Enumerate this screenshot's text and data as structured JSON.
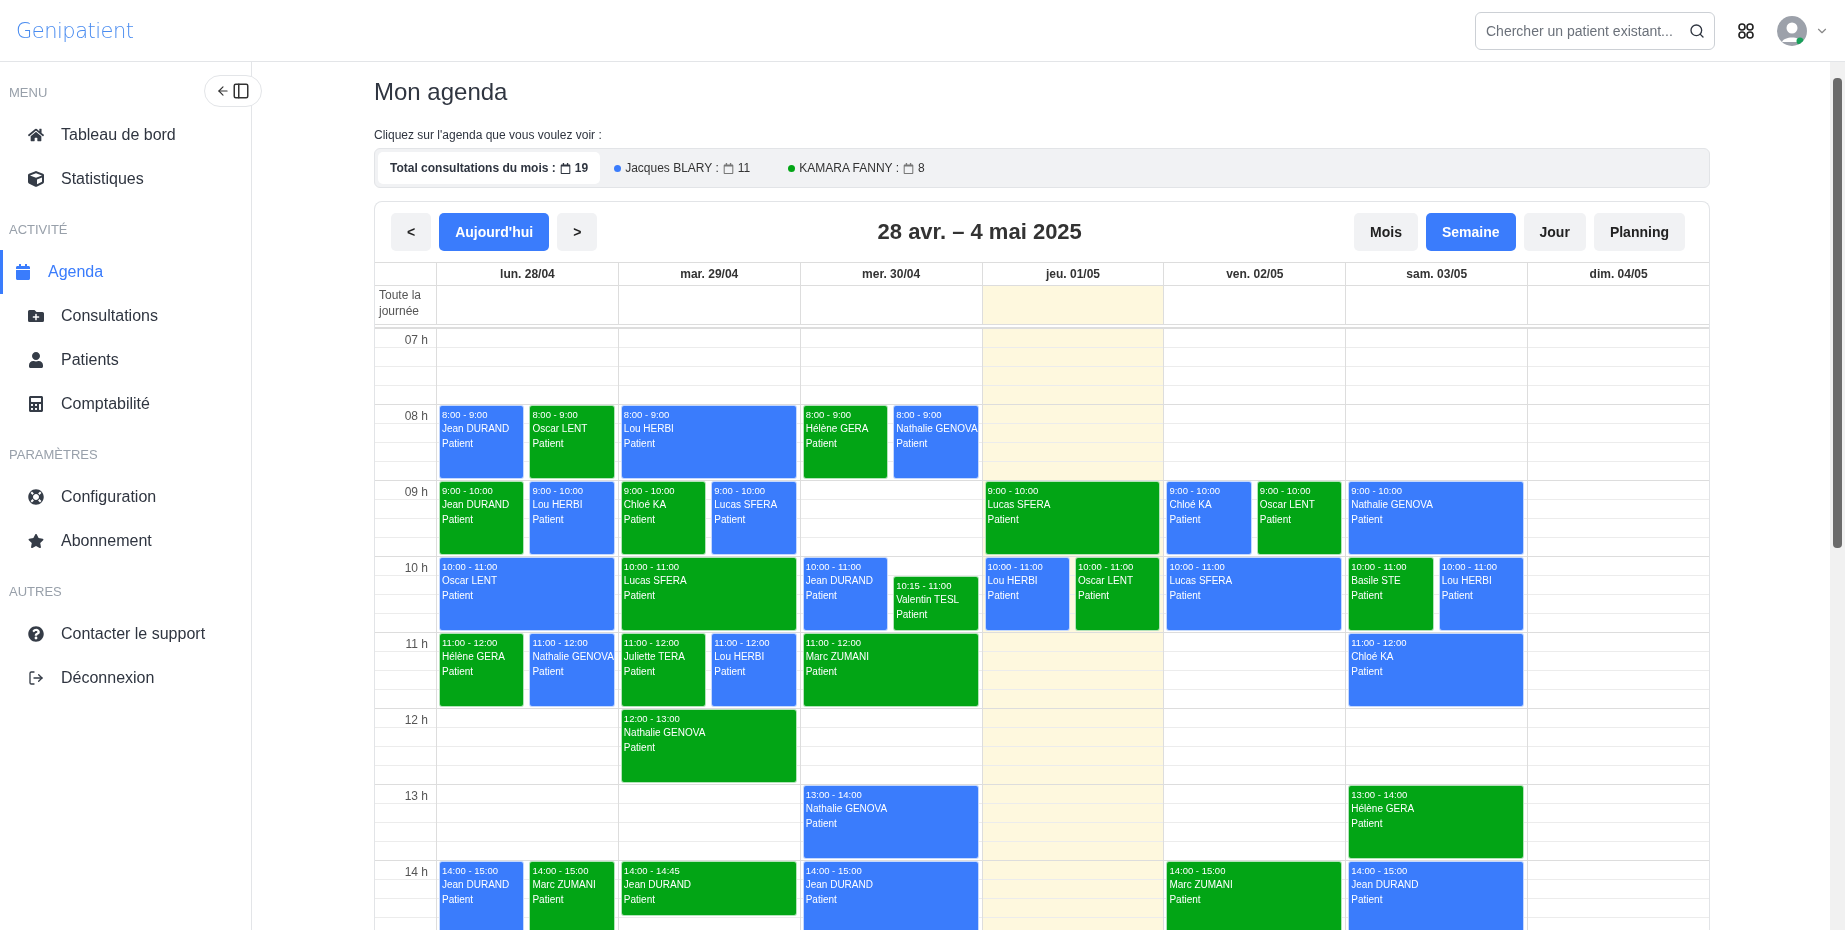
{
  "header": {
    "logo": "Genipatient",
    "search": {
      "placeholder": "Chercher un patient existant..."
    }
  },
  "sidebar": {
    "sections": [
      {
        "title": "MENU",
        "items": [
          {
            "label": "Tableau de bord",
            "selected": false
          },
          {
            "label": "Statistiques",
            "selected": false
          }
        ]
      },
      {
        "title": "ACTIVITÉ",
        "items": [
          {
            "label": "Agenda",
            "selected": true
          },
          {
            "label": "Consultations",
            "selected": false
          },
          {
            "label": "Patients",
            "selected": false
          },
          {
            "label": "Comptabilité",
            "selected": false
          }
        ]
      },
      {
        "title": "PARAMÈTRES",
        "items": [
          {
            "label": "Configuration",
            "selected": false
          },
          {
            "label": "Abonnement",
            "selected": false
          }
        ]
      },
      {
        "title": "AUTRES",
        "items": [
          {
            "label": "Contacter le support",
            "selected": false
          },
          {
            "label": "Déconnexion",
            "selected": false
          }
        ]
      }
    ]
  },
  "page": {
    "title": "Mon agenda",
    "hint": "Cliquez sur l'agenda que vous voulez voir :"
  },
  "legend": {
    "total_label": "Total consultations du mois :",
    "total": "19",
    "agendas": [
      {
        "name": "Jacques BLARY :",
        "count": "11",
        "color": "#3a7cfc"
      },
      {
        "name": "KAMARA FANNY :",
        "count": "8",
        "color": "#02a515"
      }
    ]
  },
  "calendar": {
    "nav": [
      {
        "label": "<",
        "kind": "plain"
      },
      {
        "label": "Aujourd'hui",
        "kind": "primary"
      },
      {
        "label": ">",
        "kind": "plain"
      }
    ],
    "title": "28 avr. – 4 mai 2025",
    "views": [
      {
        "label": "Mois",
        "selected": false
      },
      {
        "label": "Semaine",
        "selected": true
      },
      {
        "label": "Jour",
        "selected": false
      },
      {
        "label": "Planning",
        "selected": false
      }
    ],
    "allday_label": "Toute la journée",
    "hours": [
      "07 h",
      "08 h",
      "09 h",
      "10 h",
      "11 h",
      "12 h",
      "13 h",
      "14 h"
    ],
    "days": [
      {
        "label": "lun. 28/04",
        "today": false,
        "events": [
          {
            "time": "8:00 - 9:00",
            "name": "Jean DURAND",
            "role": "Patient",
            "color": "#3a7cfc"
          },
          {
            "time": "8:00 - 9:00",
            "name": "Oscar LENT",
            "role": "Patient",
            "color": "#02a515"
          },
          {
            "time": "9:00 - 10:00",
            "name": "Jean DURAND",
            "role": "Patient",
            "color": "#02a515"
          },
          {
            "time": "9:00 - 10:00",
            "name": "Lou HERBI",
            "role": "Patient",
            "color": "#3a7cfc"
          },
          {
            "time": "10:00 - 11:00",
            "name": "Oscar LENT",
            "role": "Patient",
            "color": "#3a7cfc"
          },
          {
            "time": "11:00 - 12:00",
            "name": "Hélène GERA",
            "role": "Patient",
            "color": "#02a515"
          },
          {
            "time": "11:00 - 12:00",
            "name": "Nathalie GENOVA",
            "role": "Patient",
            "color": "#3a7cfc"
          },
          {
            "time": "14:00 - 15:00",
            "name": "Jean DURAND",
            "role": "Patient",
            "color": "#3a7cfc"
          },
          {
            "time": "14:00 - 15:00",
            "name": "Marc ZUMANI",
            "role": "Patient",
            "color": "#02a515"
          }
        ]
      },
      {
        "label": "mar. 29/04",
        "today": false,
        "events": [
          {
            "time": "8:00 - 9:00",
            "name": "Lou HERBI",
            "role": "Patient",
            "color": "#3a7cfc"
          },
          {
            "time": "9:00 - 10:00",
            "name": "Chloé KA",
            "role": "Patient",
            "color": "#02a515"
          },
          {
            "time": "9:00 - 10:00",
            "name": "Lucas SFERA",
            "role": "Patient",
            "color": "#3a7cfc"
          },
          {
            "time": "10:00 - 11:00",
            "name": "Lucas SFERA",
            "role": "Patient",
            "color": "#02a515"
          },
          {
            "time": "11:00 - 12:00",
            "name": "Juliette TERA",
            "role": "Patient",
            "color": "#02a515"
          },
          {
            "time": "11:00 - 12:00",
            "name": "Lou HERBI",
            "role": "Patient",
            "color": "#3a7cfc"
          },
          {
            "time": "12:00 - 13:00",
            "name": "Nathalie GENOVA",
            "role": "Patient",
            "color": "#02a515"
          },
          {
            "time": "14:00 - 14:45",
            "name": "Jean DURAND",
            "role": "Patient",
            "color": "#02a515"
          }
        ]
      },
      {
        "label": "mer. 30/04",
        "today": false,
        "events": [
          {
            "time": "8:00 - 9:00",
            "name": "Hélène GERA",
            "role": "Patient",
            "color": "#02a515"
          },
          {
            "time": "8:00 - 9:00",
            "name": "Nathalie GENOVA",
            "role": "Patient",
            "color": "#3a7cfc"
          },
          {
            "time": "10:00 - 11:00",
            "name": "Jean DURAND",
            "role": "Patient",
            "color": "#3a7cfc"
          },
          {
            "time": "10:15 - 11:00",
            "name": "Valentin TESL",
            "role": "Patient",
            "color": "#02a515"
          },
          {
            "time": "11:00 - 12:00",
            "name": "Marc ZUMANI",
            "role": "Patient",
            "color": "#02a515"
          },
          {
            "time": "13:00 - 14:00",
            "name": "Nathalie GENOVA",
            "role": "Patient",
            "color": "#3a7cfc"
          },
          {
            "time": "14:00 - 15:00",
            "name": "Jean DURAND",
            "role": "Patient",
            "color": "#3a7cfc"
          }
        ]
      },
      {
        "label": "jeu. 01/05",
        "today": true,
        "events": [
          {
            "time": "9:00 - 10:00",
            "name": "Lucas SFERA",
            "role": "Patient",
            "color": "#02a515"
          },
          {
            "time": "10:00 - 11:00",
            "name": "Lou HERBI",
            "role": "Patient",
            "color": "#3a7cfc"
          },
          {
            "time": "10:00 - 11:00",
            "name": "Oscar LENT",
            "role": "Patient",
            "color": "#02a515"
          }
        ]
      },
      {
        "label": "ven. 02/05",
        "today": false,
        "events": [
          {
            "time": "9:00 - 10:00",
            "name": "Chloé KA",
            "role": "Patient",
            "color": "#3a7cfc"
          },
          {
            "time": "9:00 - 10:00",
            "name": "Oscar LENT",
            "role": "Patient",
            "color": "#02a515"
          },
          {
            "time": "10:00 - 11:00",
            "name": "Lucas SFERA",
            "role": "Patient",
            "color": "#3a7cfc"
          },
          {
            "time": "14:00 - 15:00",
            "name": "Marc ZUMANI",
            "role": "Patient",
            "color": "#02a515"
          }
        ]
      },
      {
        "label": "sam. 03/05",
        "today": false,
        "events": [
          {
            "time": "9:00 - 10:00",
            "name": "Nathalie GENOVA",
            "role": "Patient",
            "color": "#3a7cfc"
          },
          {
            "time": "10:00 - 11:00",
            "name": "Basile STE",
            "role": "Patient",
            "color": "#02a515"
          },
          {
            "time": "10:00 - 11:00",
            "name": "Lou HERBI",
            "role": "Patient",
            "color": "#3a7cfc"
          },
          {
            "time": "11:00 - 12:00",
            "name": "Chloé KA",
            "role": "Patient",
            "color": "#3a7cfc"
          },
          {
            "time": "13:00 - 14:00",
            "name": "Hélène GERA",
            "role": "Patient",
            "color": "#02a515"
          },
          {
            "time": "14:00 - 15:00",
            "name": "Jean DURAND",
            "role": "Patient",
            "color": "#3a7cfc"
          }
        ]
      },
      {
        "label": "dim. 04/05",
        "today": false
      }
    ]
  }
}
